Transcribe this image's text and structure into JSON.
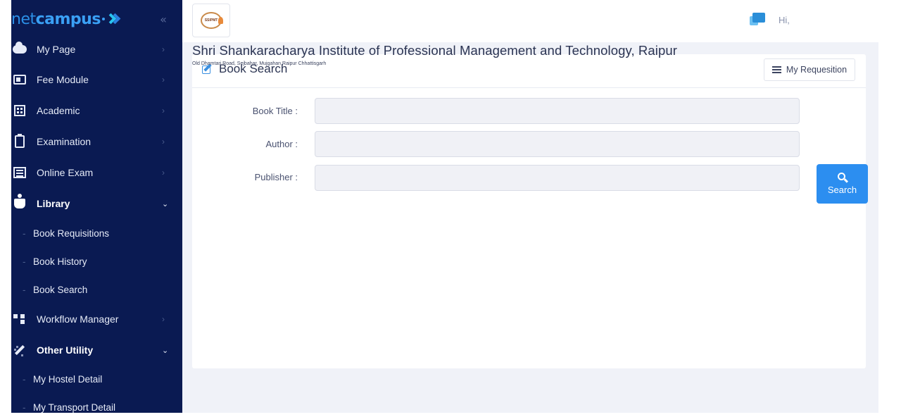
{
  "brand": {
    "net": "net",
    "campus": "campus"
  },
  "sidebar": {
    "collapse_glyph": "«",
    "items": [
      {
        "label": "My Page",
        "icon": "cloud-icon",
        "chevron": "›"
      },
      {
        "label": "Fee Module",
        "icon": "fee-icon",
        "chevron": "›"
      },
      {
        "label": "Academic",
        "icon": "academic-icon",
        "chevron": "›"
      },
      {
        "label": "Examination",
        "icon": "clipboard-icon",
        "chevron": "›"
      },
      {
        "label": "Online Exam",
        "icon": "list-screen-icon",
        "chevron": "›"
      },
      {
        "label": "Library",
        "icon": "reader-icon",
        "chevron": "⌄"
      },
      {
        "label": "Workflow Manager",
        "icon": "workflow-icon",
        "chevron": "›"
      },
      {
        "label": "Other Utility",
        "icon": "wand-icon",
        "chevron": "⌄"
      }
    ],
    "library_sub": [
      "Book Requisitions",
      "Book History",
      "Book Search"
    ],
    "utility_sub": [
      "My Hostel Detail",
      "My Transport Detail"
    ],
    "sub_dash": "-"
  },
  "topbar": {
    "logo_text": "SSIPMT",
    "greeting": "Hi,"
  },
  "institute": {
    "name": "Shri Shankaracharya Institute of Professional Management and Technology, Raipur",
    "address": "Old Dhamtari Road, Sejbahar, Mujgahan Raipur Chhattisgarh"
  },
  "card": {
    "title": "Book Search",
    "requisition_button": "My Requesition"
  },
  "form": {
    "book_title_label": "Book Title :",
    "author_label": "Author :",
    "publisher_label": "Publisher :",
    "book_title_value": "",
    "author_value": "",
    "publisher_value": "",
    "search_button": "Search"
  },
  "colors": {
    "sidebar_bg": "#0a1a52",
    "accent": "#2c8ef0",
    "page_bg": "#f0f2f8"
  }
}
